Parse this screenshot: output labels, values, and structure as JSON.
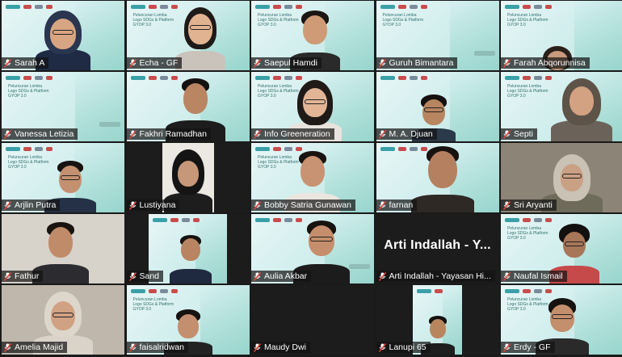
{
  "slide_text": "Peluncuran Lomba\nLogo SDGs & Platform\nGYOP 3.0",
  "colors": {
    "active_speaker": "#d6e03a",
    "muted_mic": "#e0443a",
    "label_bg": "#141414"
  },
  "participants": [
    {
      "name": "Sarah A",
      "muted": true,
      "active": true
    },
    {
      "name": "Echa - GF",
      "muted": true
    },
    {
      "name": "Saepul Hamdi",
      "muted": true
    },
    {
      "name": "Guruh Bimantara",
      "muted": true
    },
    {
      "name": "Farah Abqorunnisa",
      "muted": true
    },
    {
      "name": "Vanessa Letizia",
      "muted": true
    },
    {
      "name": "Fakhri Ramadhan",
      "muted": true
    },
    {
      "name": "Info Greeneration",
      "muted": true
    },
    {
      "name": "M. A. Djuan",
      "muted": true
    },
    {
      "name": "Septi",
      "muted": true
    },
    {
      "name": "Arjlin Putra",
      "muted": true
    },
    {
      "name": "Lustiyana",
      "muted": true
    },
    {
      "name": "Bobby Satria Gunawan",
      "muted": true
    },
    {
      "name": "farnan",
      "muted": true
    },
    {
      "name": "Sri Aryanti",
      "muted": true
    },
    {
      "name": "Fathur",
      "muted": true
    },
    {
      "name": "Sand",
      "muted": true
    },
    {
      "name": "Aulia Akbar",
      "muted": true
    },
    {
      "name": "Arti Indallah - Yayasan Hi...",
      "muted": true,
      "no_video_title": "Arti Indallah - Y..."
    },
    {
      "name": "Naufal Ismail",
      "muted": true
    },
    {
      "name": "Amelia Majid",
      "muted": true
    },
    {
      "name": "faisalridwan",
      "muted": true
    },
    {
      "name": "Maudy Dwi",
      "muted": true
    },
    {
      "name": "Lanupi 65",
      "muted": true
    },
    {
      "name": "Erdy - GF",
      "muted": true
    }
  ]
}
